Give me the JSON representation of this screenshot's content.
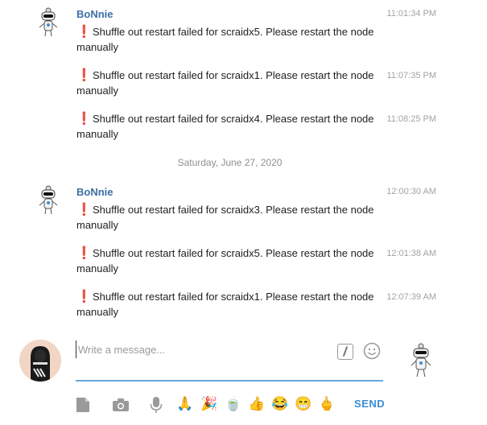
{
  "groups": [
    {
      "sender": "BoNnie",
      "messages": [
        {
          "icon": "❗",
          "text": "Shuffle out restart failed for scraidx5. Please restart the node manually",
          "time": "11:01:34 PM"
        },
        {
          "icon": "❗",
          "text": "Shuffle out restart failed for scraidx1. Please restart the node manually",
          "time": "11:07:35 PM"
        },
        {
          "icon": "❗",
          "text": "Shuffle out restart failed for scraidx4. Please restart the node manually",
          "time": "11:08:25 PM"
        }
      ]
    },
    {
      "sender": "BoNnie",
      "messages": [
        {
          "icon": "❗",
          "text": "Shuffle out restart failed for scraidx3. Please restart the node manually",
          "time": "12:00:30 AM"
        },
        {
          "icon": "❗",
          "text": "Shuffle out restart failed for scraidx5. Please restart the node manually",
          "time": "12:01:38 AM"
        },
        {
          "icon": "❗",
          "text": "Shuffle out restart failed for scraidx1. Please restart the node manually",
          "time": "12:07:39 AM"
        }
      ]
    }
  ],
  "date_separator": "Saturday, June 27, 2020",
  "composer": {
    "placeholder": "Write a message...",
    "send_label": "SEND",
    "toolbar_icons": [
      "attach-file-icon",
      "camera-icon",
      "microphone-icon",
      "folded-hands-emoji",
      "party-popper-emoji",
      "matcha-emoji",
      "thumbs-up-emoji",
      "tears-of-joy-emoji",
      "grinning-emoji",
      "middle-finger-emoji"
    ],
    "quick_emojis": {
      "pray": "🙏",
      "party": "🎉",
      "matcha": "🍵",
      "thumbs": "👍",
      "joy": "😂",
      "grin": "😁",
      "finger": "🖕"
    }
  },
  "colors": {
    "sender": "#3d6fa3",
    "accent": "#3a8ed6",
    "exclamation": "#d93025",
    "timestamp": "#a3a3a3"
  }
}
